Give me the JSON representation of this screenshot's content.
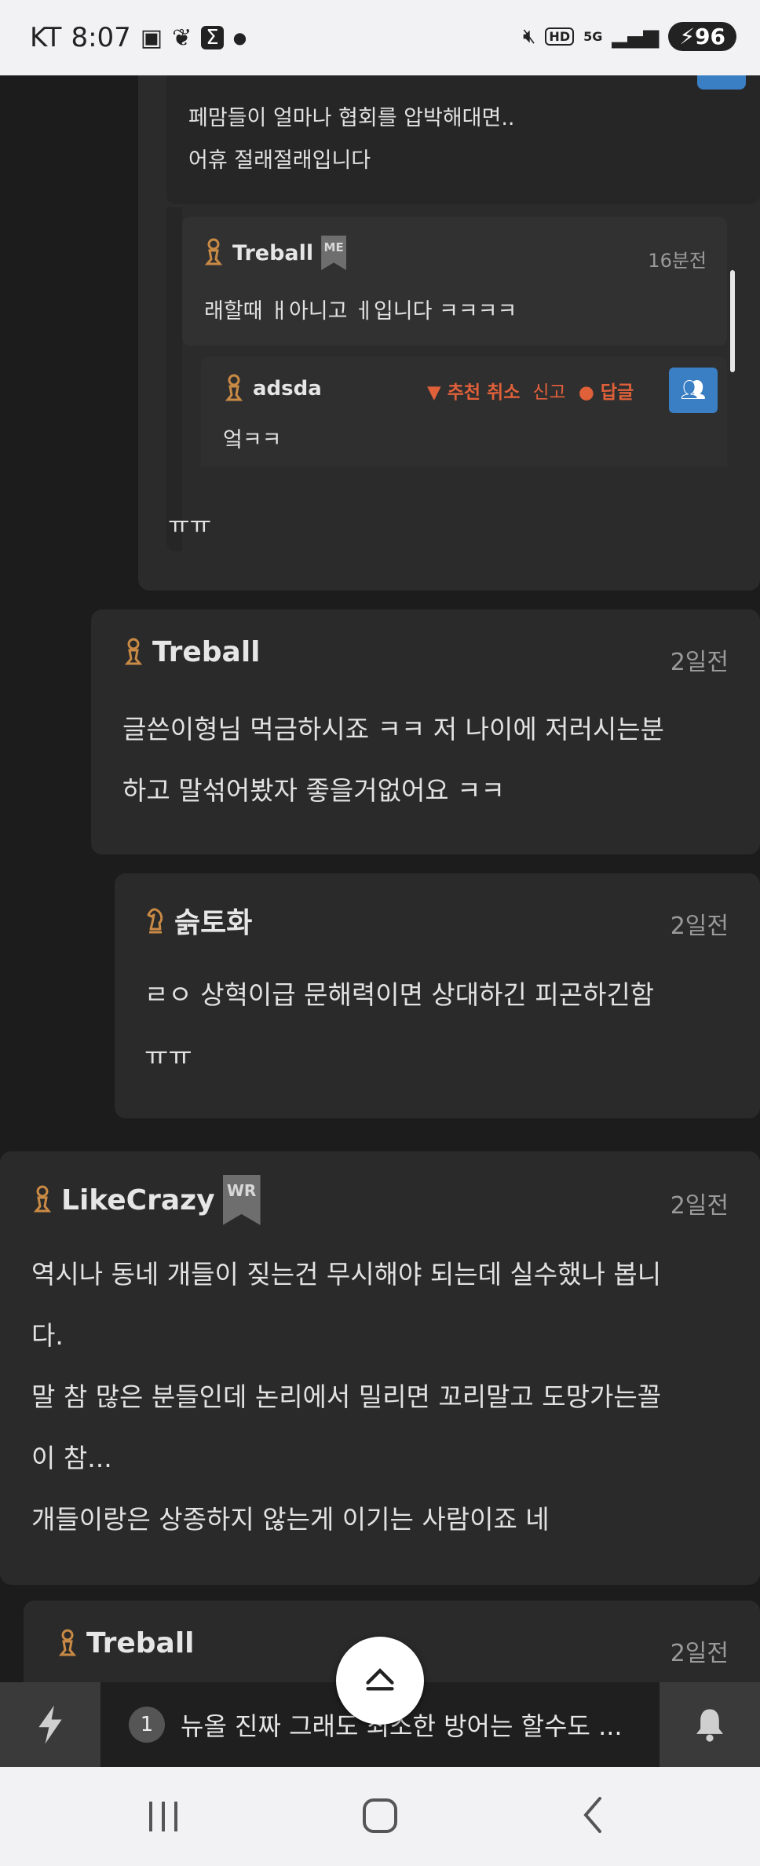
{
  "status_bar": {
    "carrier": "KT",
    "time": "8:07",
    "battery": "96"
  },
  "comments": [
    {
      "lines": [
        "페맘들이 얼마나 협회를 압박해대면..",
        "어휴 절래절래입니다"
      ]
    },
    {
      "user": "Treball",
      "badge": "ME",
      "time": "16분전",
      "text": "래할때 ㅐ아니고 ㅔ입니다 ㅋㅋㅋㅋ"
    },
    {
      "user": "adsda",
      "actions": {
        "recommend_cancel": "추천 취소",
        "report": "신고",
        "reply": "답글"
      },
      "text": "엌ㅋㅋ"
    },
    {
      "text": "ㅠㅠ"
    },
    {
      "user": "Treball",
      "time": "2일전",
      "lines": [
        "글쓴이형님 먹금하시죠 ㅋㅋ 저 나이에 저러시는분",
        "하고 말섞어봤자 좋을거없어요 ㅋㅋ"
      ]
    },
    {
      "user": "슭토화",
      "time": "2일전",
      "lines": [
        "ㄹㅇ 상혁이급 문해력이면  상대하긴 피곤하긴함",
        "ㅠㅠ"
      ]
    },
    {
      "user": "LikeCrazy",
      "badge": "WR",
      "time": "2일전",
      "lines": [
        "역시나 동네 개들이 짖는건 무시해야 되는데 실수했나 봅니",
        "다.",
        "말 참 많은 분들인데 논리에서 밀리면 꼬리말고 도망가는꼴",
        "이 참...",
        "개들이랑은 상종하지 않는게 이기는 사람이죠 네"
      ]
    },
    {
      "user": "Treball",
      "time": "2일전"
    }
  ],
  "bottom_bar": {
    "count": "1",
    "ticker_text": "뉴올 진짜 그래도 최소한 방어는 할수도 ..."
  },
  "icons": {
    "user_level": "pawn-icon",
    "user_level_alt": "knight-icon",
    "thumb": "thumbs-down-icon",
    "reply": "speech-bubble-icon",
    "group": "group-icon",
    "scroll_top": "chevron-up-icon",
    "flash": "lightning-icon",
    "notify": "bell-icon"
  },
  "colors": {
    "background": "#1c1c1c",
    "card": "#2a2a2a",
    "accent": "#e0603a",
    "pawn": "#c98a45",
    "group_button": "#3a7ec4"
  }
}
